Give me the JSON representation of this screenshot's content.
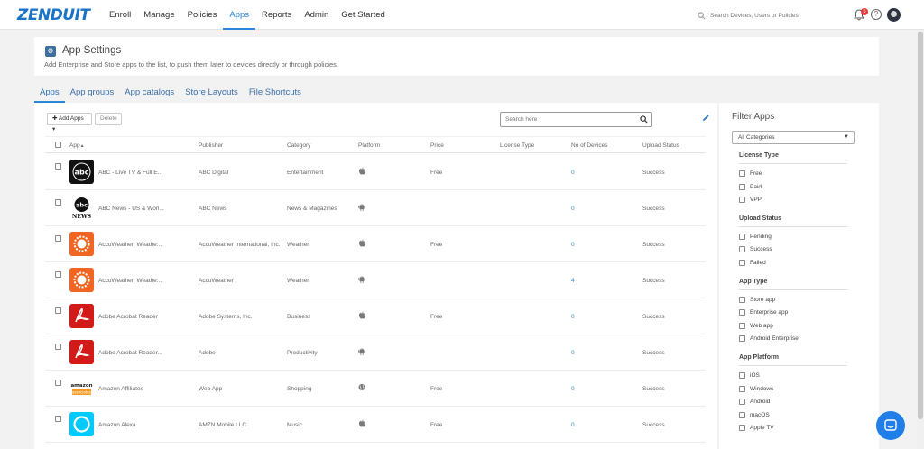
{
  "nav": {
    "logo": "ZENDUIT",
    "items": [
      "Enroll",
      "Manage",
      "Policies",
      "Apps",
      "Reports",
      "Admin",
      "Get Started"
    ],
    "active_index": 3,
    "search_placeholder": "Search Devices, Users or Policies",
    "notification_count": "5",
    "help_label": "?"
  },
  "header": {
    "title": "App Settings",
    "subtitle": "Add Enterprise and Store apps to the list, to push them later to devices directly or through policies."
  },
  "tabs": [
    {
      "label": "Apps",
      "active": true
    },
    {
      "label": "App groups",
      "active": false
    },
    {
      "label": "App catalogs",
      "active": false
    },
    {
      "label": "Store Layouts",
      "active": false
    },
    {
      "label": "File Shortcuts",
      "active": false
    }
  ],
  "toolbar": {
    "add_label": "Add Apps",
    "delete_label": "Delete",
    "search_placeholder": "Search here"
  },
  "table": {
    "columns": [
      "App",
      "Publisher",
      "Category",
      "Platform",
      "Price",
      "License Type",
      "No of Devices",
      "Upload Status"
    ],
    "sort_indicator": "▲",
    "rows": [
      {
        "app": "ABC - Live TV & Full E...",
        "publisher": "ABC Digital",
        "category": "Entertainment",
        "platform": "apple-icon",
        "price": "Free",
        "license": "",
        "devices": "0",
        "status": "Success",
        "icon": "abc"
      },
      {
        "app": "ABC News - US & Worl...",
        "publisher": "ABC News",
        "category": "News & Magazines",
        "platform": "android-icon",
        "price": "",
        "license": "",
        "devices": "0",
        "status": "Success",
        "icon": "abcnews"
      },
      {
        "app": "AccuWeather: Weathe...",
        "publisher": "AccuWeather International, Inc.",
        "category": "Weather",
        "platform": "apple-icon",
        "price": "Free",
        "license": "",
        "devices": "0",
        "status": "Success",
        "icon": "accuweather"
      },
      {
        "app": "AccuWeather: Weathe...",
        "publisher": "AccuWeather",
        "category": "Weather",
        "platform": "android-icon",
        "price": "",
        "license": "",
        "devices": "4",
        "status": "Success",
        "icon": "accuweather"
      },
      {
        "app": "Adobe Acrobat Reader",
        "publisher": "Adobe Systems, Inc.",
        "category": "Business",
        "platform": "apple-icon",
        "price": "Free",
        "license": "",
        "devices": "0",
        "status": "Success",
        "icon": "acrobat"
      },
      {
        "app": "Adobe Acrobat Reader...",
        "publisher": "Adobe",
        "category": "Productivity",
        "platform": "android-icon",
        "price": "",
        "license": "",
        "devices": "0",
        "status": "Success",
        "icon": "acrobat"
      },
      {
        "app": "Amazon Affiliates",
        "publisher": "Web App",
        "category": "Shopping",
        "platform": "globe-icon",
        "price": "Free",
        "license": "",
        "devices": "0",
        "status": "Success",
        "icon": "amazon"
      },
      {
        "app": "Amazon Alexa",
        "publisher": "AMZN Mobile LLC",
        "category": "Music",
        "platform": "apple-icon",
        "price": "Free",
        "license": "",
        "devices": "0",
        "status": "Success",
        "icon": "alexa"
      }
    ]
  },
  "filters": {
    "title": "Filter Apps",
    "category_select": "All Categories",
    "groups": [
      {
        "heading": "License Type",
        "options": [
          "Free",
          "Paid",
          "VPP"
        ]
      },
      {
        "heading": "Upload Status",
        "options": [
          "Pending",
          "Success",
          "Failed"
        ]
      },
      {
        "heading": "App Type",
        "options": [
          "Store app",
          "Enterprise app",
          "Web app",
          "Android Enterprise"
        ]
      },
      {
        "heading": "App Platform",
        "options": [
          "iOS",
          "Windows",
          "Android",
          "macOS",
          "Apple TV"
        ]
      }
    ]
  },
  "colors": {
    "accent": "#2a86d6",
    "link": "#3b82c4",
    "logo": "#1a73c8",
    "chat": "#1f7ee8"
  }
}
